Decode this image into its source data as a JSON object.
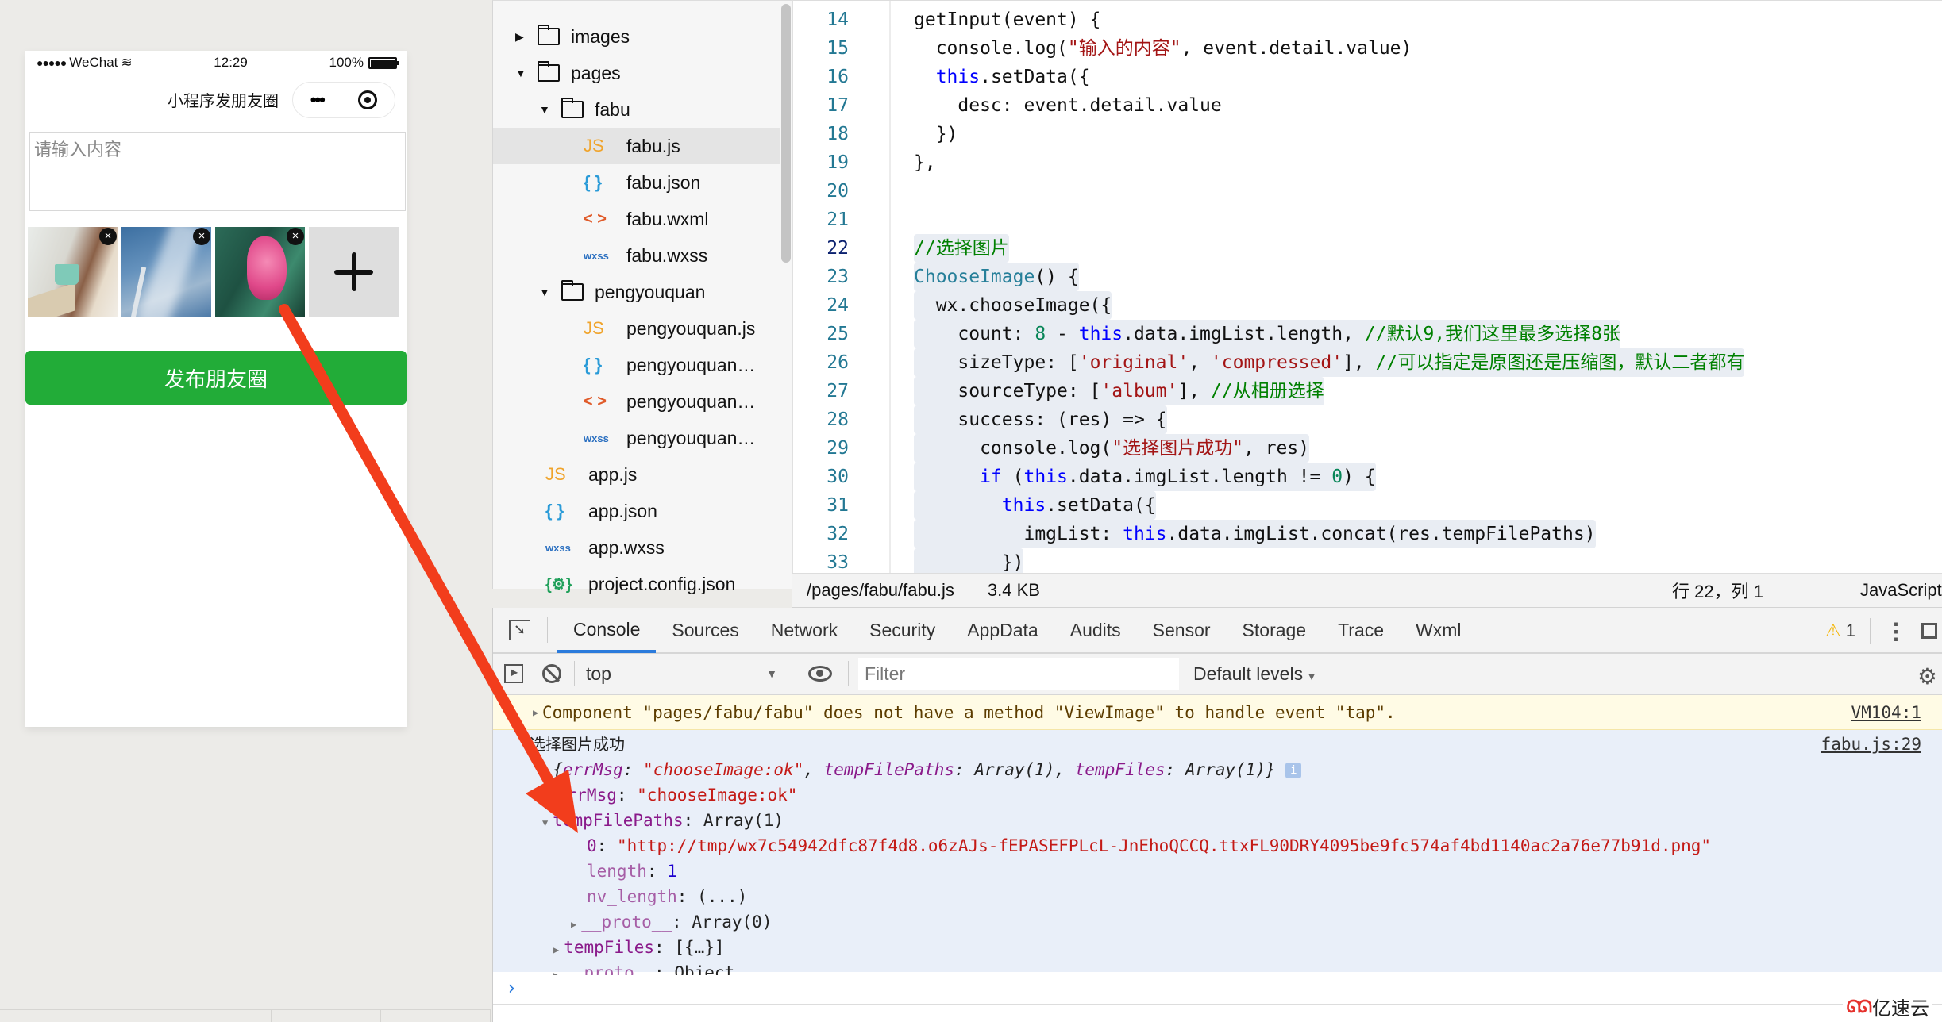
{
  "simulator": {
    "status_bar": {
      "signal": "●●●●●",
      "carrier": "WeChat",
      "wifi_icon": "wifi-icon",
      "time": "12:29",
      "battery": "100%"
    },
    "nav_title": "小程序发朋友圈",
    "capsule_more": "•••",
    "desc_placeholder": "请输入内容",
    "images": [
      {
        "name": "woman-with-cup",
        "close": "×"
      },
      {
        "name": "wind-turbine-sky",
        "close": "×"
      },
      {
        "name": "pink-flower",
        "close": "×"
      }
    ],
    "add_icon": "plus-icon",
    "publish_button": "发布朋友圈"
  },
  "file_tree": {
    "items": [
      {
        "label": "images",
        "type": "folder",
        "expanded": false,
        "depth": 0
      },
      {
        "label": "pages",
        "type": "folder",
        "expanded": true,
        "depth": 0
      },
      {
        "label": "fabu",
        "type": "folder",
        "expanded": true,
        "depth": 1
      },
      {
        "label": "fabu.js",
        "type": "js",
        "icon": "JS",
        "depth": 2,
        "selected": true
      },
      {
        "label": "fabu.json",
        "type": "json",
        "icon": "{ }",
        "depth": 2
      },
      {
        "label": "fabu.wxml",
        "type": "wxml",
        "icon": "< >",
        "depth": 2
      },
      {
        "label": "fabu.wxss",
        "type": "wxss",
        "icon": "wxss",
        "depth": 2
      },
      {
        "label": "pengyouquan",
        "type": "folder",
        "expanded": true,
        "depth": 1
      },
      {
        "label": "pengyouquan.js",
        "type": "js",
        "icon": "JS",
        "depth": 2
      },
      {
        "label": "pengyouquan…",
        "type": "json",
        "icon": "{ }",
        "depth": 2
      },
      {
        "label": "pengyouquan…",
        "type": "wxml",
        "icon": "< >",
        "depth": 2
      },
      {
        "label": "pengyouquan…",
        "type": "wxss",
        "icon": "wxss",
        "depth": 2
      },
      {
        "label": "app.js",
        "type": "js",
        "icon": "JS",
        "depth": 1
      },
      {
        "label": "app.json",
        "type": "json",
        "icon": "{ }",
        "depth": 1
      },
      {
        "label": "app.wxss",
        "type": "wxss",
        "icon": "wxss",
        "depth": 1
      },
      {
        "label": "project.config.json",
        "type": "cfg",
        "icon": "{⚙}",
        "depth": 1
      }
    ]
  },
  "editor": {
    "active_line": 22,
    "lines": [
      {
        "n": "14",
        "tokens": [
          [
            "",
            "getInput(event) {"
          ]
        ]
      },
      {
        "n": "15",
        "tokens": [
          [
            "",
            "  console.log("
          ],
          [
            "str",
            "\"输入的内容\""
          ],
          [
            "",
            ", event.detail.value)"
          ]
        ]
      },
      {
        "n": "16",
        "tokens": [
          [
            "",
            "  "
          ],
          [
            "kw",
            "this"
          ],
          [
            "",
            ".setData({"
          ]
        ]
      },
      {
        "n": "17",
        "tokens": [
          [
            "",
            "    desc: event.detail.value"
          ]
        ]
      },
      {
        "n": "18",
        "tokens": [
          [
            "",
            "  })"
          ]
        ]
      },
      {
        "n": "19",
        "tokens": [
          [
            "",
            "},"
          ]
        ]
      },
      {
        "n": "20",
        "tokens": []
      },
      {
        "n": "21",
        "tokens": []
      },
      {
        "n": "22",
        "tokens": [
          [
            "cm",
            "//选择图片"
          ]
        ],
        "hl": true
      },
      {
        "n": "23",
        "tokens": [
          [
            "fn",
            "ChooseImage"
          ],
          [
            "",
            "() {"
          ]
        ],
        "hl": true
      },
      {
        "n": "24",
        "tokens": [
          [
            "",
            "  wx.chooseImage({"
          ]
        ],
        "hl": true
      },
      {
        "n": "25",
        "tokens": [
          [
            "",
            "    count: "
          ],
          [
            "num",
            "8"
          ],
          [
            "",
            " - "
          ],
          [
            "kw",
            "this"
          ],
          [
            "",
            ".data.imgList.length, "
          ],
          [
            "cm",
            "//默认9,我们这里最多选择8张"
          ]
        ],
        "hl": true
      },
      {
        "n": "26",
        "tokens": [
          [
            "",
            "    sizeType: ["
          ],
          [
            "str",
            "'original'"
          ],
          [
            "",
            ", "
          ],
          [
            "str",
            "'compressed'"
          ],
          [
            "",
            "], "
          ],
          [
            "cm",
            "//可以指定是原图还是压缩图，默认二者都有"
          ]
        ],
        "hl": true
      },
      {
        "n": "27",
        "tokens": [
          [
            "",
            "    sourceType: ["
          ],
          [
            "str",
            "'album'"
          ],
          [
            "",
            "], "
          ],
          [
            "cm",
            "//从相册选择"
          ]
        ],
        "hl": true
      },
      {
        "n": "28",
        "tokens": [
          [
            "",
            "    success: (res) => {"
          ]
        ],
        "hl": true
      },
      {
        "n": "29",
        "tokens": [
          [
            "",
            "      console.log("
          ],
          [
            "str",
            "\"选择图片成功\""
          ],
          [
            "",
            ", res)"
          ]
        ],
        "hl": true
      },
      {
        "n": "30",
        "tokens": [
          [
            "",
            "      "
          ],
          [
            "kw",
            "if"
          ],
          [
            "",
            " ("
          ],
          [
            "kw",
            "this"
          ],
          [
            "",
            ".data.imgList.length != "
          ],
          [
            "num",
            "0"
          ],
          [
            "",
            ") {"
          ]
        ],
        "hl": true
      },
      {
        "n": "31",
        "tokens": [
          [
            "",
            "        "
          ],
          [
            "kw",
            "this"
          ],
          [
            "",
            ".setData({"
          ]
        ],
        "hl": true
      },
      {
        "n": "32",
        "tokens": [
          [
            "",
            "          imgList: "
          ],
          [
            "kw",
            "this"
          ],
          [
            "",
            ".data.imgList.concat(res.tempFilePaths)"
          ]
        ],
        "hl": true
      },
      {
        "n": "33",
        "tokens": [
          [
            "",
            "        })"
          ]
        ],
        "hl": true
      }
    ],
    "status": {
      "path": "/pages/fabu/fabu.js",
      "size": "3.4 KB",
      "position": "行 22，列 1",
      "language": "JavaScript"
    }
  },
  "devtools": {
    "tabs": [
      "Console",
      "Sources",
      "Network",
      "Security",
      "AppData",
      "Audits",
      "Sensor",
      "Storage",
      "Trace",
      "Wxml"
    ],
    "active_tab": "Console",
    "warning_count": "1",
    "context": "top",
    "filter_placeholder": "Filter",
    "levels": "Default levels",
    "console": {
      "warning": {
        "text": "Component \"pages/fabu/fabu\" does not have a method \"ViewImage\" to handle event \"tap\".",
        "source": "VM104:1"
      },
      "log": {
        "label": "选择图片成功",
        "source": "fabu.js:29",
        "summary_open": "{",
        "summary_k1": "errMsg",
        "summary_v1": "\"chooseImage:ok\"",
        "summary_k2": "tempFilePaths",
        "summary_v2": "Array(1)",
        "summary_k3": "tempFiles",
        "summary_v3": "Array(1)",
        "summary_close": "}",
        "info": "i",
        "errMsg_key": "errMsg",
        "errMsg_val": "\"chooseImage:ok\"",
        "tfp_key": "tempFilePaths",
        "tfp_val": "Array(1)",
        "idx0_key": "0",
        "idx0_val": "\"http://tmp/wx7c54942dfc87f4d8.o6zAJs-fEPASEFPLcL-JnEhoQCCQ.ttxFL90DRY4095be9fc574af4bd1140ac2a76e77b91d.png\"",
        "length_key": "length",
        "length_val": "1",
        "nvlen_key": "nv_length",
        "nvlen_val": "(...)",
        "proto_arr_key": "__proto__",
        "proto_arr_val": "Array(0)",
        "tempFiles_key": "tempFiles",
        "tempFiles_val": "[{…}]",
        "proto_obj_key": "__proto__",
        "proto_obj_val": "Object"
      },
      "prompt": "›"
    }
  },
  "annotation": {
    "arrow_color": "#f23d1c"
  },
  "watermark": "亿速云"
}
